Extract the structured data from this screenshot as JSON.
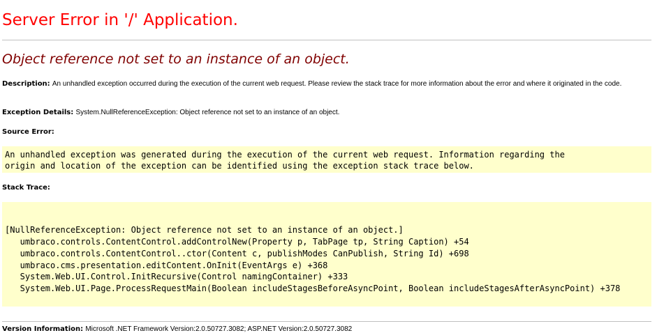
{
  "header": {
    "title": "Server Error in '/' Application.",
    "message": "Object reference not set to an instance of an object."
  },
  "description": {
    "label": "Description:",
    "text": "An unhandled exception occurred during the execution of the current web request. Please review the stack trace for more information about the error and where it originated in the code."
  },
  "exception_details": {
    "label": "Exception Details:",
    "text": "System.NullReferenceException: Object reference not set to an instance of an object."
  },
  "source_error": {
    "label": "Source Error:",
    "lines": [
      "An unhandled exception was generated during the execution of the current web request. Information regarding the",
      "origin and location of the exception can be identified using the exception stack trace below."
    ]
  },
  "stack_trace": {
    "label": "Stack Trace:",
    "lines": [
      "[NullReferenceException: Object reference not set to an instance of an object.]",
      "   umbraco.controls.ContentControl.addControlNew(Property p, TabPage tp, String Caption) +54",
      "   umbraco.controls.ContentControl..ctor(Content c, publishModes CanPublish, String Id) +698",
      "   umbraco.cms.presentation.editContent.OnInit(EventArgs e) +368",
      "   System.Web.UI.Control.InitRecursive(Control namingContainer) +333",
      "   System.Web.UI.Page.ProcessRequestMain(Boolean includeStagesBeforeAsyncPoint, Boolean includeStagesAfterAsyncPoint) +378"
    ]
  },
  "version_info": {
    "label": "Version Information:",
    "text": "Microsoft .NET Framework Version:2.0.50727.3082; ASP.NET Version:2.0.50727.3082"
  },
  "colors": {
    "title": "#ff0000",
    "message": "#800000",
    "code_background": "#ffffcc",
    "rule": "#c0c0c0"
  }
}
